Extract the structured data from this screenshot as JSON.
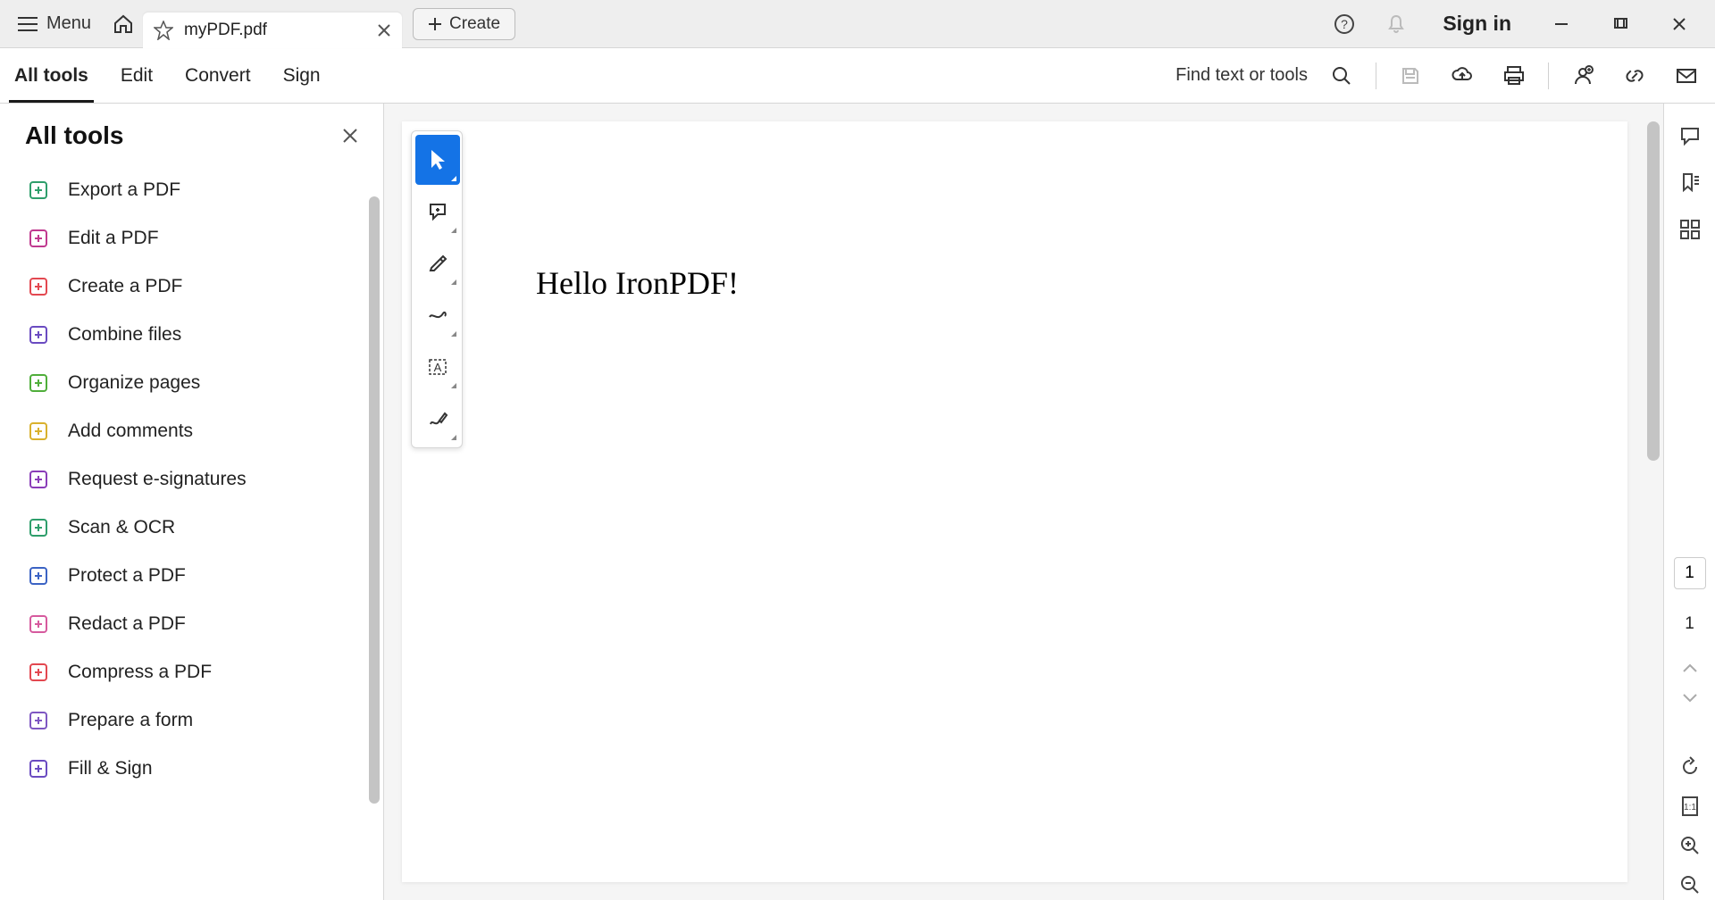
{
  "titlebar": {
    "menu_label": "Menu",
    "tab_title": "myPDF.pdf",
    "create_label": "Create",
    "signin_label": "Sign in"
  },
  "secbar": {
    "items": [
      "All tools",
      "Edit",
      "Convert",
      "Sign"
    ],
    "find_label": "Find text or tools"
  },
  "leftpanel": {
    "title": "All tools",
    "tools": [
      {
        "label": "Export a PDF",
        "icon": "export-pdf-icon",
        "color": "#2e9e6b"
      },
      {
        "label": "Edit a PDF",
        "icon": "edit-pdf-icon",
        "color": "#c0398f"
      },
      {
        "label": "Create a PDF",
        "icon": "create-pdf-icon",
        "color": "#e34850"
      },
      {
        "label": "Combine files",
        "icon": "combine-icon",
        "color": "#6a4bc1"
      },
      {
        "label": "Organize pages",
        "icon": "organize-icon",
        "color": "#4fae3a"
      },
      {
        "label": "Add comments",
        "icon": "comment-icon",
        "color": "#d9b12e"
      },
      {
        "label": "Request e-signatures",
        "icon": "esign-icon",
        "color": "#8a3db8"
      },
      {
        "label": "Scan & OCR",
        "icon": "scan-icon",
        "color": "#2e9e6b"
      },
      {
        "label": "Protect a PDF",
        "icon": "protect-icon",
        "color": "#3b63c4"
      },
      {
        "label": "Redact a PDF",
        "icon": "redact-icon",
        "color": "#d65a9e"
      },
      {
        "label": "Compress a PDF",
        "icon": "compress-icon",
        "color": "#e34850"
      },
      {
        "label": "Prepare a form",
        "icon": "form-icon",
        "color": "#7e57c2"
      },
      {
        "label": "Fill & Sign",
        "icon": "fillsign-icon",
        "color": "#6a4bc1"
      }
    ]
  },
  "document": {
    "content": "Hello IronPDF!"
  },
  "page_nav": {
    "current": "1",
    "total": "1"
  }
}
